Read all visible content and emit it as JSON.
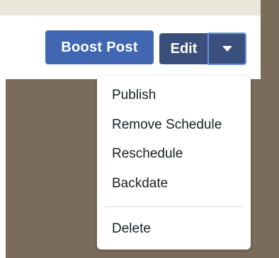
{
  "post_actions": {
    "boost_label": "Boost Post",
    "edit_label": "Edit",
    "dropdown_icon": "caret-down-icon"
  },
  "menu": {
    "items": [
      {
        "label": "Publish"
      },
      {
        "label": "Remove Schedule"
      },
      {
        "label": "Reschedule"
      },
      {
        "label": "Backdate"
      }
    ],
    "danger_items": [
      {
        "label": "Delete"
      }
    ]
  },
  "colors": {
    "primary_button": "#4267b2",
    "edit_button": "#3b4f7c",
    "background": "#7a6b5b",
    "menu_text": "#1c1e21"
  }
}
